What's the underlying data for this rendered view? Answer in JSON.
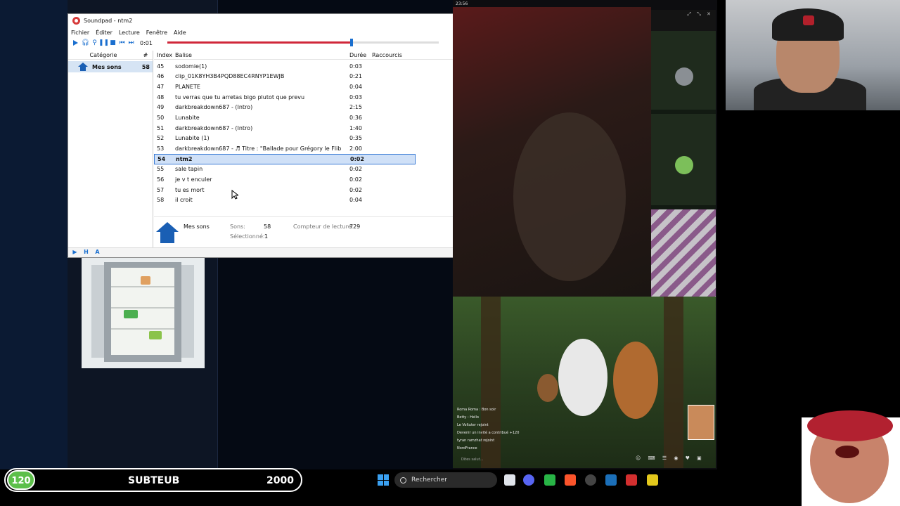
{
  "window": {
    "title": "Soundpad - ntm2",
    "minimize": "─",
    "maximize": "☐",
    "close": "✕"
  },
  "menu": [
    "Fichier",
    "Éditer",
    "Lecture",
    "Fenêtre",
    "Aide"
  ],
  "player": {
    "time": "0:01",
    "progress": 0.68,
    "volume": 1.0
  },
  "categories": {
    "header": {
      "name": "Catégorie",
      "count": "#"
    },
    "items": [
      {
        "name": "Mes sons",
        "count": "58"
      }
    ]
  },
  "sounds": {
    "header": {
      "index": "Index",
      "tag": "Balise",
      "duration": "Durée",
      "shortcuts": "Raccourcis"
    },
    "rows": [
      {
        "index": "45",
        "tag": "sodomie(1)",
        "duration": "0:03"
      },
      {
        "index": "46",
        "tag": "clip_01K8YH3B4PQD88EC4RNYP1EWJB",
        "duration": "0:21"
      },
      {
        "index": "47",
        "tag": "PLANETE",
        "duration": "0:04"
      },
      {
        "index": "48",
        "tag": "tu verras que tu arretas bigo plutot que prevu",
        "duration": "0:03"
      },
      {
        "index": "49",
        "tag": "darkbreakdown687 - (Intro)",
        "duration": "2:15"
      },
      {
        "index": "50",
        "tag": "Lunabite",
        "duration": "0:36"
      },
      {
        "index": "51",
        "tag": "darkbreakdown687 - (Intro)",
        "duration": "1:40"
      },
      {
        "index": "52",
        "tag": "Lunabite (1)",
        "duration": "0:35"
      },
      {
        "index": "53",
        "tag": "darkbreakdown687 - ♬ Titre : \"Ballade pour Grégory le Flib",
        "duration": "2:00"
      },
      {
        "index": "54",
        "tag": "ntm2",
        "duration": "0:02",
        "selected": true
      },
      {
        "index": "55",
        "tag": "sale tapin",
        "duration": "0:02"
      },
      {
        "index": "56",
        "tag": "je v t enculer",
        "duration": "0:02"
      },
      {
        "index": "57",
        "tag": "tu es mort",
        "duration": "0:02"
      },
      {
        "index": "58",
        "tag": "il croit",
        "duration": "0:04"
      }
    ]
  },
  "info": {
    "category": "Mes sons",
    "sounds_label": "Sons:",
    "sounds_value": "58",
    "selected_label": "Sélectionné:",
    "selected_value": "1",
    "counter_label": "Compteur de lecture:",
    "counter_value": "729"
  },
  "statusbar": {
    "b1": "▶",
    "b2": "H",
    "b3": "A"
  },
  "stream": {
    "top_time": "23:56",
    "chat": [
      "Roma Roma : Bon soir",
      "Betty : Hello",
      "Le Voltuter rejoint",
      "Devenir un invité a contribué +120",
      "tyran ramzhat rejoint",
      "NordFrance"
    ],
    "chat_placeholder": "Dites salut..."
  },
  "overlay": {
    "count": "120",
    "name": "SUBTEUB",
    "goal": "2000"
  },
  "taskbar": {
    "search_label": "Rechercher"
  }
}
